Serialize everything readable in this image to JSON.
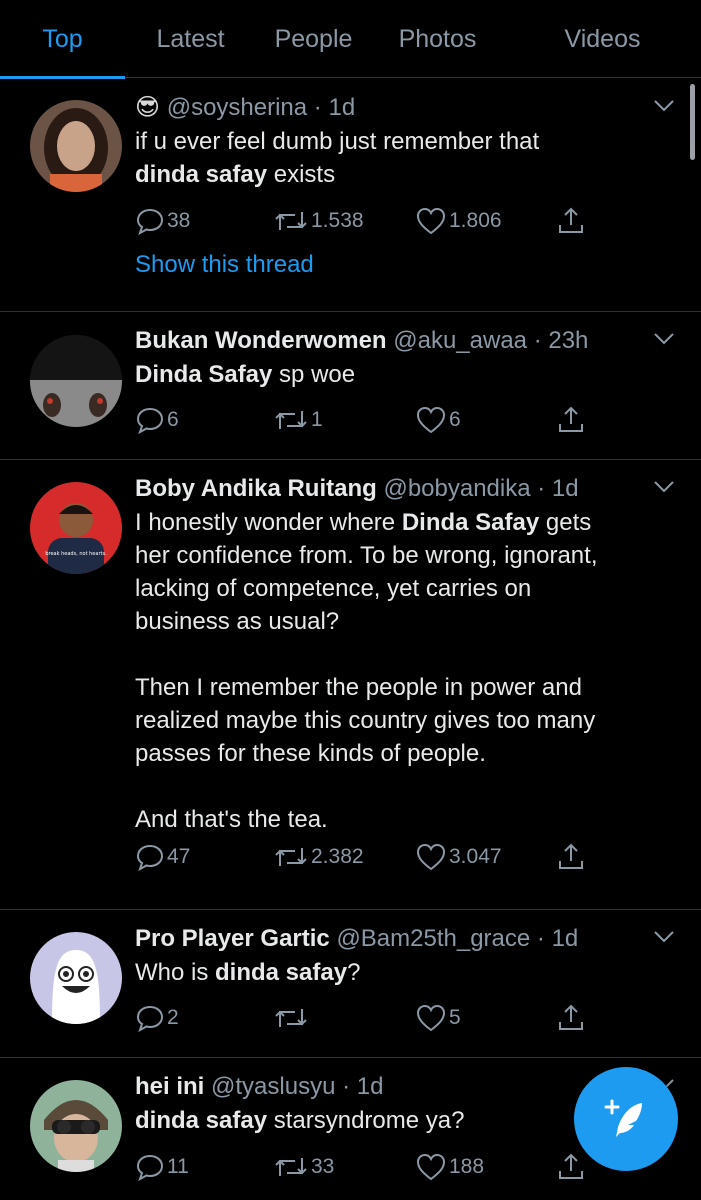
{
  "tabs": [
    "Top",
    "Latest",
    "People",
    "Photos",
    "Videos"
  ],
  "active_tab": "Top",
  "tweets": [
    {
      "emoji": "😎",
      "name": "",
      "handle": "@soysherina",
      "time": "1d",
      "text_parts": [
        {
          "t": "if u ever feel dumb just remember that\n",
          "b": false
        },
        {
          "t": "dinda safay",
          "b": true
        },
        {
          "t": " exists",
          "b": false
        }
      ],
      "replies": "38",
      "retweets": "1.538",
      "likes": "1.806",
      "show_thread": "Show this thread"
    },
    {
      "name": "Bukan Wonderwomen",
      "handle": "@aku_awaa",
      "time": "23h",
      "text_parts": [
        {
          "t": "Dinda Safay",
          "b": true
        },
        {
          "t": " sp woe",
          "b": false
        }
      ],
      "replies": "6",
      "retweets": "1",
      "likes": "6"
    },
    {
      "name": "Boby Andika Ruitang",
      "handle": "@bobyandika",
      "time": "1d",
      "text_parts": [
        {
          "t": "I honestly wonder where ",
          "b": false
        },
        {
          "t": "Dinda Safay",
          "b": true
        },
        {
          "t": " gets\nher confidence from. To be wrong, ignorant,\nlacking of competence, yet carries on\nbusiness as usual?\n\nThen I remember the people in power and\nrealized maybe this country gives too many\npasses for these kinds of people.\n\nAnd that's the tea.",
          "b": false
        }
      ],
      "replies": "47",
      "retweets": "2.382",
      "likes": "3.047",
      "avatar_shirt_text": "break heads, not hearts."
    },
    {
      "name": "Pro Player Gartic",
      "handle": "@Bam25th_grace",
      "time": "1d",
      "text_parts": [
        {
          "t": "Who is ",
          "b": false
        },
        {
          "t": "dinda safay",
          "b": true
        },
        {
          "t": "?",
          "b": false
        }
      ],
      "replies": "2",
      "retweets": "",
      "likes": "5"
    },
    {
      "name": "hei ini",
      "handle": "@tyaslusyu",
      "time": "1d",
      "text_parts": [
        {
          "t": "dinda safay",
          "b": true
        },
        {
          "t": " starsyndrome ya?",
          "b": false
        }
      ],
      "replies": "11",
      "retweets": "33",
      "likes": "188"
    }
  ],
  "colors": {
    "accent": "#1d9bf0",
    "background": "#000000",
    "divider": "#2f3336",
    "muted": "#8b98a5"
  },
  "icons": {
    "reply": "speech-bubble-icon",
    "retweet": "retweet-icon",
    "like": "heart-icon",
    "share": "share-icon",
    "caret": "chevron-down-icon",
    "compose": "compose-feather-icon"
  }
}
